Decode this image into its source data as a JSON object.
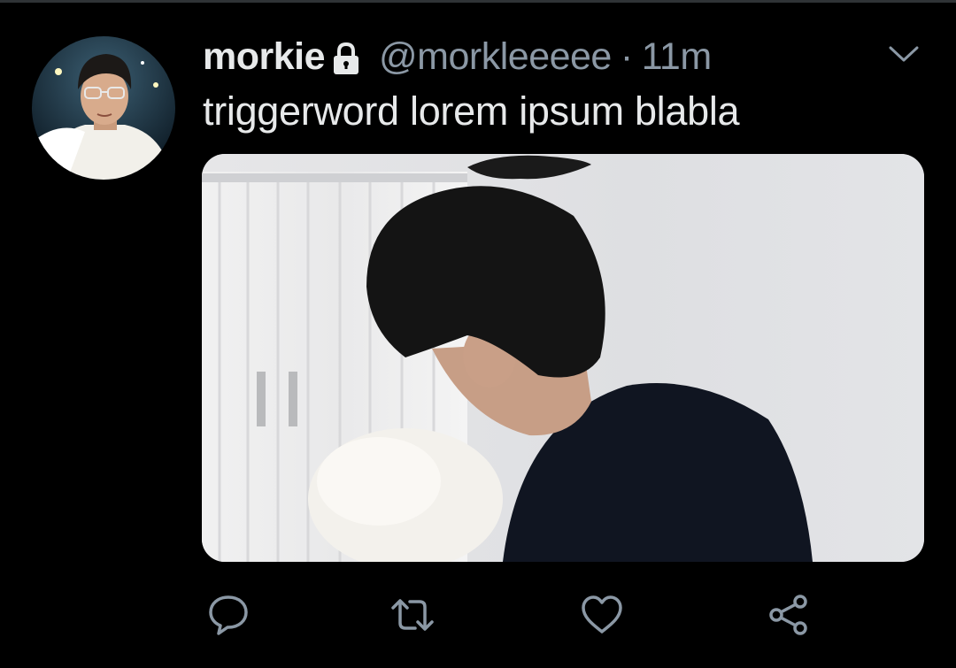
{
  "tweet": {
    "display_name": "morkie",
    "handle": "@morkleeeee",
    "separator": "·",
    "timestamp": "11m",
    "text": "triggerword lorem ipsum blabla",
    "protected_icon": "lock-icon",
    "menu_icon": "chevron-down-icon"
  },
  "actions": [
    {
      "name": "reply",
      "icon": "reply-icon"
    },
    {
      "name": "retweet",
      "icon": "retweet-icon"
    },
    {
      "name": "like",
      "icon": "heart-icon"
    },
    {
      "name": "share",
      "icon": "share-icon"
    }
  ],
  "colors": {
    "background": "#000000",
    "primary_text": "#e7e9ea",
    "secondary_text": "#8b98a5",
    "icon": "#8b98a5"
  }
}
